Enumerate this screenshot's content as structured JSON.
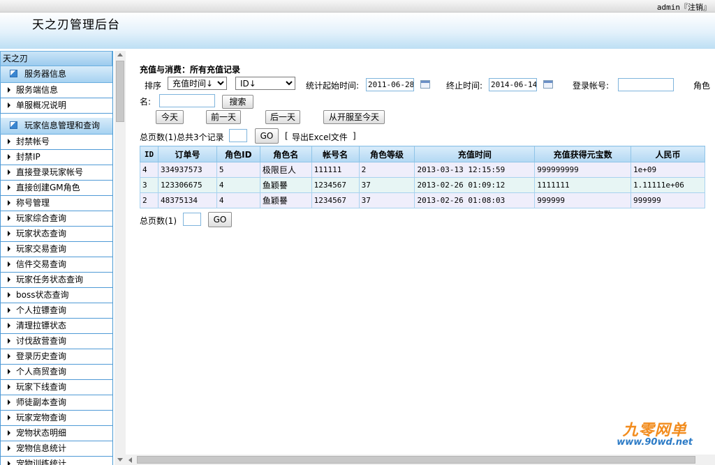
{
  "header": {
    "title": "天之刃管理后台",
    "user": "admin",
    "logout_label": "『注销』"
  },
  "sidebar": {
    "root_label": "天之刃",
    "group1": {
      "label": "服务器信息",
      "items": [
        "服务端信息",
        "单服概况说明"
      ]
    },
    "group2": {
      "label": "玩家信息管理和查询",
      "items": [
        "封禁帐号",
        "封禁IP",
        "直接登录玩家帐号",
        "直接创建GM角色",
        "称号管理",
        "玩家综合查询",
        "玩家状态查询",
        "玩家交易查询",
        "信件交易查询",
        "玩家任务状态查询",
        "boss状态查询",
        "个人拉镖查询",
        "清理拉镖状态",
        "讨伐敌营查询",
        "登录历史查询",
        "个人商贸查询",
        "玩家下线查询",
        "师徒副本查询",
        "玩家宠物查询",
        "宠物状态明细",
        "宠物信息统计",
        "宠物训练统计"
      ]
    }
  },
  "main": {
    "heading": "充值与消费：所有充值记录",
    "sort_label": "排序",
    "sort_select_1": "充值时间↓",
    "sort_select_2": "ID↓",
    "start_label": "统计起始时间:",
    "start_value": "2011-06-28",
    "end_label": "终止时间:",
    "end_value": "2014-06-14",
    "account_label": "登录帐号:",
    "account_value": "",
    "role_label_1": "角色",
    "role_label_2": "名:",
    "role_value": "",
    "search_button": "搜索",
    "today_button": "今天",
    "prev_day_button": "前一天",
    "next_day_button": "后一天",
    "since_open_button": "从开服至今天",
    "pager_top": "总页数(1)总共3个记录",
    "go_button": "GO",
    "export_prefix": "[",
    "export_link": "导出Excel文件",
    "export_suffix": "]",
    "pager_bottom": "总页数(1)"
  },
  "table": {
    "columns": [
      "ID",
      "订单号",
      "角色ID",
      "角色名",
      "帐号名",
      "角色等级",
      "充值时间",
      "充值获得元宝数",
      "人民币"
    ],
    "rows": [
      [
        "4",
        "334937573",
        "5",
        "极限巨人",
        "111111",
        "2",
        "2013-03-13 12:15:59",
        "999999999",
        "1e+09"
      ],
      [
        "3",
        "123306675",
        "4",
        "鱼颖謈",
        "1234567",
        "37",
        "2013-02-26 01:09:12",
        "1111111",
        "1.11111e+06"
      ],
      [
        "2",
        "48375134",
        "4",
        "鱼颖謈",
        "1234567",
        "37",
        "2013-02-26 01:08:03",
        "999999",
        "999999"
      ]
    ]
  },
  "watermark": {
    "top": "九零网单",
    "bottom": "www.90wd.net"
  }
}
